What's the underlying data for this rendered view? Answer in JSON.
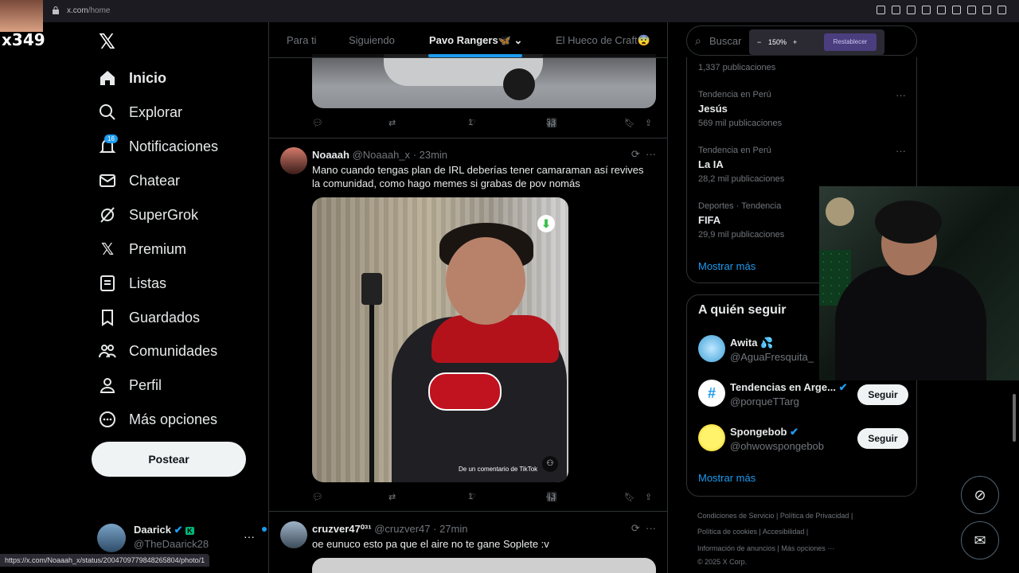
{
  "browser": {
    "url_host": "x.com",
    "url_path": "/home",
    "status_url": "https://x.com/Noaaah_x/status/2004709779848265804/photo/1"
  },
  "overlay": {
    "streamer_tag": "x349"
  },
  "sidebar": {
    "items": [
      {
        "label": "Inicio",
        "icon": "home-icon"
      },
      {
        "label": "Explorar",
        "icon": "search-icon"
      },
      {
        "label": "Notificaciones",
        "icon": "bell-icon"
      },
      {
        "label": "Chatear",
        "icon": "mail-icon"
      },
      {
        "label": "SuperGrok",
        "icon": "grok-icon"
      },
      {
        "label": "Premium",
        "icon": "x-logo-icon"
      },
      {
        "label": "Listas",
        "icon": "list-icon"
      },
      {
        "label": "Guardados",
        "icon": "bookmark-icon"
      },
      {
        "label": "Comunidades",
        "icon": "people-icon"
      },
      {
        "label": "Perfil",
        "icon": "person-icon"
      },
      {
        "label": "Más opciones",
        "icon": "more-circle-icon"
      }
    ],
    "notif_badge": "16",
    "post_label": "Postear",
    "user": {
      "name": "Daarick",
      "handle": "@TheDaarick28"
    }
  },
  "tabs": [
    "Para ti",
    "Siguiendo",
    "Pavo Rangers🦋",
    "El Hueco de Craft😨"
  ],
  "active_tab": "Pavo Rangers🦋",
  "prev_post": {
    "likes": "1",
    "views": "38"
  },
  "posts": [
    {
      "name": "Noaaah",
      "handle": "@Noaaah_x",
      "time": "· 23min",
      "text": "Mano cuando tengas plan de IRL deberías tener camaraman así revives la comunidad, como hago memes si grabas de pov nomás",
      "likes": "1",
      "views": "43",
      "media_watermark": "De un comentario de TikTok"
    },
    {
      "name": "cruzver47⁰³¹",
      "handle": "@cruzver47",
      "time": "· 27min",
      "text": "oe eunuco esto pa que el aire no te gane Soplete :v"
    }
  ],
  "search": {
    "placeholder": "Buscar"
  },
  "zoom": {
    "minus": "−",
    "level": "150%",
    "plus": "+",
    "reset": "Restablecer"
  },
  "trends": {
    "first_count": "1,337 publicaciones",
    "items": [
      {
        "meta": "Tendencia en Perú",
        "name": "Jesús",
        "count": "569 mil publicaciones"
      },
      {
        "meta": "Tendencia en Perú",
        "name": "La IA",
        "count": "28,2 mil publicaciones"
      },
      {
        "meta": "Deportes · Tendencia",
        "name": "FIFA",
        "count": "29,9 mil publicaciones"
      }
    ],
    "show_more": "Mostrar más"
  },
  "who_to_follow": {
    "title": "A quién seguir",
    "accounts": [
      {
        "name": "Awita 💦",
        "handle": "@AguaFresquita_"
      },
      {
        "name": "Tendencias en Arge...",
        "handle": "@porqueTTarg",
        "button": "Seguir"
      },
      {
        "name": "Spongebob",
        "handle": "@ohwowspongebob",
        "button": "Seguir"
      }
    ],
    "show_more": "Mostrar más"
  },
  "footer": {
    "line1": "Condiciones de Servicio  |  Política de Privacidad  |",
    "line2": "Política de cookies  |  Accesibilidad  |",
    "line3": "Información de anuncios  |  Más opciones ···",
    "line4": "© 2025 X Corp."
  }
}
